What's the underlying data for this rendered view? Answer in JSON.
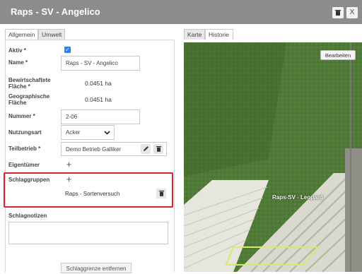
{
  "window": {
    "title": "Raps - SV - Angelico",
    "delete_icon": "trash-icon",
    "close_label": "X"
  },
  "left_tabs": [
    {
      "label": "Allgemein"
    },
    {
      "label": "Umwelt"
    }
  ],
  "right_tabs": [
    {
      "label": "Karte"
    },
    {
      "label": "Historie"
    }
  ],
  "form": {
    "aktiv_label": "Aktiv *",
    "name_label": "Name *",
    "name_value": "Raps - SV - Angelico",
    "bewirtschaftete_label_1": "Bewirtschaftete",
    "bewirtschaftete_label_2": "Fläche *",
    "bewirtschaftete_value": "0.0451 ha",
    "geographische_label_1": "Geographische",
    "geographische_label_2": "Fläche",
    "geographische_value": "0.0451 ha",
    "nummer_label": "Nummer *",
    "nummer_value": "2-06",
    "nutzungsart_label": "Nutzungsart",
    "nutzungsart_value": "Acker",
    "teilbetrieb_label": "Teilbetrieb *",
    "teilbetrieb_value": "Demo Betrieb Galliker",
    "eigentuemer_label": "Eigentümer",
    "schlaggruppen_label": "Schlaggruppen",
    "schlaggruppen_item": "Raps - Sortenversuch",
    "schlagnotizen_label": "Schlagnotizen",
    "remove_button": "Schlaggrenze entfernen"
  },
  "map": {
    "edit_button": "Bearbeiten",
    "field_label": "Raps-SV - Leopard"
  }
}
